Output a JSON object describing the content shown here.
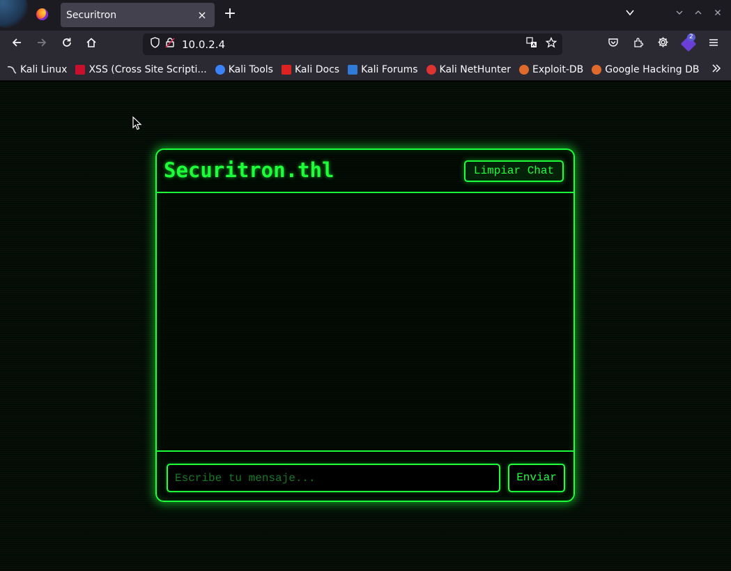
{
  "browser": {
    "tab_title": "Securitron",
    "tab_close": "×",
    "new_tab": "+",
    "url": "10.0.2.4"
  },
  "bookmarks": [
    {
      "label": "Kali Linux",
      "color": "#2b2a33"
    },
    {
      "label": "XSS (Cross Site Scripti...",
      "color": "#c8102e"
    },
    {
      "label": "Kali Tools",
      "color": "#3b82f6"
    },
    {
      "label": "Kali Docs",
      "color": "#d22"
    },
    {
      "label": "Kali Forums",
      "color": "#2f7bd6"
    },
    {
      "label": "Kali NetHunter",
      "color": "#d33"
    },
    {
      "label": "Exploit-DB",
      "color": "#e06a2c"
    },
    {
      "label": "Google Hacking DB",
      "color": "#e06a2c"
    }
  ],
  "chat": {
    "title": "Securitron.thl",
    "clear_label": "Limpiar Chat",
    "input_placeholder": "Escribe tu mensaje...",
    "send_label": "Enviar",
    "accent_color": "#1dff3a"
  }
}
